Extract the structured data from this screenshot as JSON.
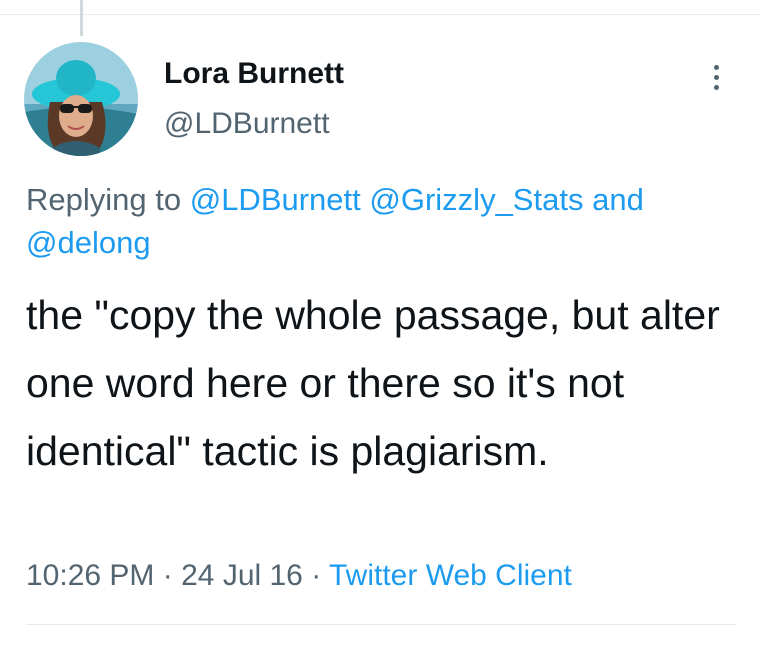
{
  "author": {
    "display_name": "Lora Burnett",
    "handle": "@LDBurnett"
  },
  "reply": {
    "prefix": "Replying to",
    "mentions": [
      "@LDBurnett",
      "@Grizzly_Stats",
      "@delong"
    ],
    "conjunction": "and"
  },
  "tweet": {
    "text": "the \"copy the whole passage, but alter one word here or there so it's not identical\" tactic is plagiarism."
  },
  "meta": {
    "time": "10:26 PM",
    "separator": "·",
    "date": "24 Jul 16",
    "source": "Twitter Web Client"
  },
  "icons": {
    "more": "more-vertical-icon"
  },
  "colors": {
    "link": "#1d9bf0",
    "secondary_text": "#536471",
    "primary_text": "#0f1419"
  }
}
